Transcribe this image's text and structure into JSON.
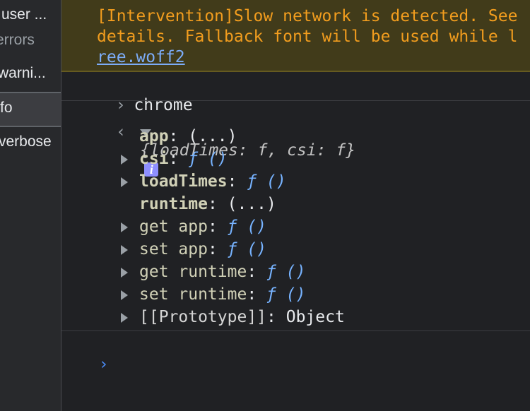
{
  "sidebar": {
    "items": [
      {
        "label": "user ..."
      },
      {
        "label": "errors"
      },
      {
        "label": "warni..."
      },
      {
        "label": "fo"
      },
      {
        "label": "verbose"
      }
    ]
  },
  "warning": {
    "line1": "[Intervention]Slow network is detected. See",
    "line2": "details. Fallback font will be used while ",
    "line2_tail": "l",
    "link": "ree.woff2"
  },
  "console": {
    "input_command": "chrome",
    "output_summary": {
      "open": "{",
      "k1": "loadTimes",
      "v1": "f",
      "k2": "csi",
      "v2": "f",
      "close": "}",
      "info_glyph": "i"
    },
    "properties": [
      {
        "key": "app",
        "value": "(...)",
        "expandable": false,
        "value_type": "plain"
      },
      {
        "key": "csi",
        "value": "ƒ ()",
        "expandable": true,
        "value_type": "function"
      },
      {
        "key": "loadTimes",
        "value": "ƒ ()",
        "expandable": true,
        "value_type": "function"
      },
      {
        "key": "runtime",
        "value": "(...)",
        "expandable": false,
        "value_type": "plain"
      },
      {
        "key": "get app",
        "value": "ƒ ()",
        "expandable": true,
        "value_type": "function"
      },
      {
        "key": "set app",
        "value": "ƒ ()",
        "expandable": true,
        "value_type": "function"
      },
      {
        "key": "get runtime",
        "value": "ƒ ()",
        "expandable": true,
        "value_type": "function"
      },
      {
        "key": "set runtime",
        "value": "ƒ ()",
        "expandable": true,
        "value_type": "function"
      },
      {
        "key": "[[Prototype]]",
        "value": "Object",
        "expandable": true,
        "value_type": "plain"
      }
    ],
    "prompt_glyph": "›"
  },
  "colors": {
    "background": "#202124",
    "warning_text": "#f29d1e",
    "warning_bg": "#413b1a",
    "link": "#7cacf8",
    "function": "#77b3ff",
    "key": "#d1d1b7",
    "info_badge": "#8e8fff"
  }
}
